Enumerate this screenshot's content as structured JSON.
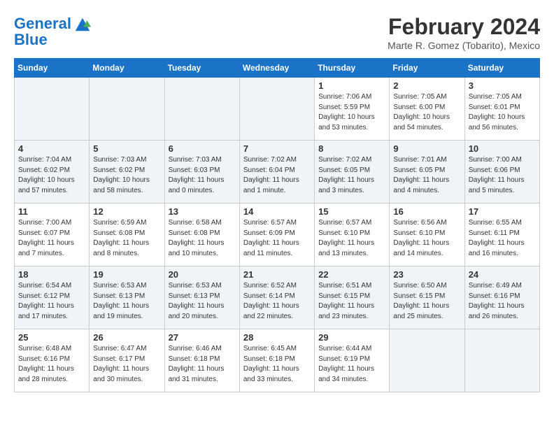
{
  "header": {
    "logo_line1": "General",
    "logo_line2": "Blue",
    "month_title": "February 2024",
    "location": "Marte R. Gomez (Tobarito), Mexico"
  },
  "weekdays": [
    "Sunday",
    "Monday",
    "Tuesday",
    "Wednesday",
    "Thursday",
    "Friday",
    "Saturday"
  ],
  "weeks": [
    [
      {
        "day": "",
        "info": ""
      },
      {
        "day": "",
        "info": ""
      },
      {
        "day": "",
        "info": ""
      },
      {
        "day": "",
        "info": ""
      },
      {
        "day": "1",
        "info": "Sunrise: 7:06 AM\nSunset: 5:59 PM\nDaylight: 10 hours\nand 53 minutes."
      },
      {
        "day": "2",
        "info": "Sunrise: 7:05 AM\nSunset: 6:00 PM\nDaylight: 10 hours\nand 54 minutes."
      },
      {
        "day": "3",
        "info": "Sunrise: 7:05 AM\nSunset: 6:01 PM\nDaylight: 10 hours\nand 56 minutes."
      }
    ],
    [
      {
        "day": "4",
        "info": "Sunrise: 7:04 AM\nSunset: 6:02 PM\nDaylight: 10 hours\nand 57 minutes."
      },
      {
        "day": "5",
        "info": "Sunrise: 7:03 AM\nSunset: 6:02 PM\nDaylight: 10 hours\nand 58 minutes."
      },
      {
        "day": "6",
        "info": "Sunrise: 7:03 AM\nSunset: 6:03 PM\nDaylight: 11 hours\nand 0 minutes."
      },
      {
        "day": "7",
        "info": "Sunrise: 7:02 AM\nSunset: 6:04 PM\nDaylight: 11 hours\nand 1 minute."
      },
      {
        "day": "8",
        "info": "Sunrise: 7:02 AM\nSunset: 6:05 PM\nDaylight: 11 hours\nand 3 minutes."
      },
      {
        "day": "9",
        "info": "Sunrise: 7:01 AM\nSunset: 6:05 PM\nDaylight: 11 hours\nand 4 minutes."
      },
      {
        "day": "10",
        "info": "Sunrise: 7:00 AM\nSunset: 6:06 PM\nDaylight: 11 hours\nand 5 minutes."
      }
    ],
    [
      {
        "day": "11",
        "info": "Sunrise: 7:00 AM\nSunset: 6:07 PM\nDaylight: 11 hours\nand 7 minutes."
      },
      {
        "day": "12",
        "info": "Sunrise: 6:59 AM\nSunset: 6:08 PM\nDaylight: 11 hours\nand 8 minutes."
      },
      {
        "day": "13",
        "info": "Sunrise: 6:58 AM\nSunset: 6:08 PM\nDaylight: 11 hours\nand 10 minutes."
      },
      {
        "day": "14",
        "info": "Sunrise: 6:57 AM\nSunset: 6:09 PM\nDaylight: 11 hours\nand 11 minutes."
      },
      {
        "day": "15",
        "info": "Sunrise: 6:57 AM\nSunset: 6:10 PM\nDaylight: 11 hours\nand 13 minutes."
      },
      {
        "day": "16",
        "info": "Sunrise: 6:56 AM\nSunset: 6:10 PM\nDaylight: 11 hours\nand 14 minutes."
      },
      {
        "day": "17",
        "info": "Sunrise: 6:55 AM\nSunset: 6:11 PM\nDaylight: 11 hours\nand 16 minutes."
      }
    ],
    [
      {
        "day": "18",
        "info": "Sunrise: 6:54 AM\nSunset: 6:12 PM\nDaylight: 11 hours\nand 17 minutes."
      },
      {
        "day": "19",
        "info": "Sunrise: 6:53 AM\nSunset: 6:13 PM\nDaylight: 11 hours\nand 19 minutes."
      },
      {
        "day": "20",
        "info": "Sunrise: 6:53 AM\nSunset: 6:13 PM\nDaylight: 11 hours\nand 20 minutes."
      },
      {
        "day": "21",
        "info": "Sunrise: 6:52 AM\nSunset: 6:14 PM\nDaylight: 11 hours\nand 22 minutes."
      },
      {
        "day": "22",
        "info": "Sunrise: 6:51 AM\nSunset: 6:15 PM\nDaylight: 11 hours\nand 23 minutes."
      },
      {
        "day": "23",
        "info": "Sunrise: 6:50 AM\nSunset: 6:15 PM\nDaylight: 11 hours\nand 25 minutes."
      },
      {
        "day": "24",
        "info": "Sunrise: 6:49 AM\nSunset: 6:16 PM\nDaylight: 11 hours\nand 26 minutes."
      }
    ],
    [
      {
        "day": "25",
        "info": "Sunrise: 6:48 AM\nSunset: 6:16 PM\nDaylight: 11 hours\nand 28 minutes."
      },
      {
        "day": "26",
        "info": "Sunrise: 6:47 AM\nSunset: 6:17 PM\nDaylight: 11 hours\nand 30 minutes."
      },
      {
        "day": "27",
        "info": "Sunrise: 6:46 AM\nSunset: 6:18 PM\nDaylight: 11 hours\nand 31 minutes."
      },
      {
        "day": "28",
        "info": "Sunrise: 6:45 AM\nSunset: 6:18 PM\nDaylight: 11 hours\nand 33 minutes."
      },
      {
        "day": "29",
        "info": "Sunrise: 6:44 AM\nSunset: 6:19 PM\nDaylight: 11 hours\nand 34 minutes."
      },
      {
        "day": "",
        "info": ""
      },
      {
        "day": "",
        "info": ""
      }
    ]
  ]
}
